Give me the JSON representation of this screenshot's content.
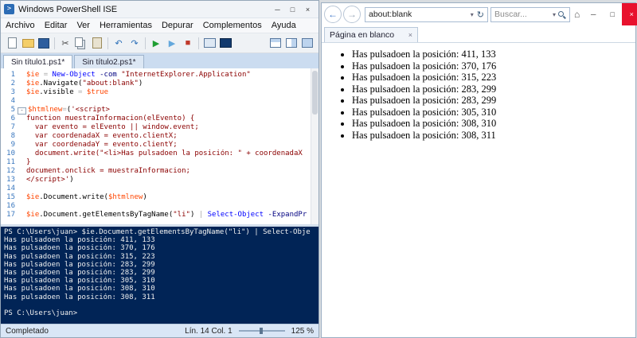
{
  "icons": {
    "app_glyph": ">",
    "ise_minimize": "─",
    "ise_maximize": "□",
    "ise_close": "×",
    "ie_minimize": "─",
    "ie_maximize": "□",
    "ie_close": "×",
    "ie_back": "←",
    "ie_forward": "→",
    "ie_refresh": "↻",
    "ie_dropdown": "▾",
    "ie_home": "⌂",
    "ie_tab_close": "×"
  },
  "ise": {
    "title": "Windows PowerShell ISE",
    "menu": [
      "Archivo",
      "Editar",
      "Ver",
      "Herramientas",
      "Depurar",
      "Complementos",
      "Ayuda"
    ],
    "toolbar": [
      {
        "name": "new-script",
        "kind": "shape"
      },
      {
        "name": "open-script",
        "kind": "shape"
      },
      {
        "name": "save-script",
        "kind": "shape"
      },
      {
        "name": "sep"
      },
      {
        "name": "cut",
        "kind": "glyph",
        "glyph": "✂",
        "color": "#444444"
      },
      {
        "name": "copy",
        "kind": "shape"
      },
      {
        "name": "paste",
        "kind": "shape"
      },
      {
        "name": "sep"
      },
      {
        "name": "undo",
        "kind": "glyph",
        "glyph": "↶",
        "color": "#2b6fb8"
      },
      {
        "name": "redo",
        "kind": "glyph",
        "glyph": "↷",
        "color": "#2b6fb8"
      },
      {
        "name": "sep"
      },
      {
        "name": "run-script",
        "kind": "glyph",
        "glyph": "▶",
        "color": "#1e9e32"
      },
      {
        "name": "run-selection",
        "kind": "glyph",
        "glyph": "▶",
        "color": "#64a8dc"
      },
      {
        "name": "stop-operation",
        "kind": "glyph",
        "glyph": "■",
        "color": "#c0392b"
      },
      {
        "name": "sep"
      },
      {
        "name": "new-remote-powershell-tab",
        "kind": "shape"
      },
      {
        "name": "start-powershell",
        "kind": "shape"
      }
    ],
    "toolbar_right": [
      {
        "name": "show-script-pane-top",
        "kind": "shape"
      },
      {
        "name": "show-script-pane-right",
        "kind": "shape"
      },
      {
        "name": "show-script-pane-maximized",
        "kind": "shape"
      }
    ],
    "tabs": [
      {
        "label": "Sin título1.ps1*",
        "active": true
      },
      {
        "label": "Sin título2.ps1*",
        "active": false
      }
    ],
    "editor_lines": [
      {
        "n": 1,
        "segs": [
          [
            "variable",
            "$ie"
          ],
          [
            "plain",
            " "
          ],
          [
            "operator",
            "="
          ],
          [
            "plain",
            " "
          ],
          [
            "cmdlet",
            "New-Object"
          ],
          [
            "plain",
            " "
          ],
          [
            "parameter",
            "-com"
          ],
          [
            "plain",
            " "
          ],
          [
            "string",
            "\"InternetExplorer.Application\""
          ]
        ]
      },
      {
        "n": 2,
        "segs": [
          [
            "variable",
            "$ie"
          ],
          [
            "plain",
            ".Navigate("
          ],
          [
            "string",
            "\"about:blank\""
          ],
          [
            "plain",
            ")"
          ]
        ]
      },
      {
        "n": 3,
        "segs": [
          [
            "variable",
            "$ie"
          ],
          [
            "plain",
            ".visible "
          ],
          [
            "operator",
            "="
          ],
          [
            "plain",
            " "
          ],
          [
            "variable",
            "$true"
          ]
        ]
      },
      {
        "n": 4,
        "segs": []
      },
      {
        "n": 5,
        "fold": true,
        "segs": [
          [
            "variable",
            "$htmlnew"
          ],
          [
            "operator",
            "="
          ],
          [
            "plain",
            "("
          ],
          [
            "string",
            "'<script>"
          ]
        ]
      },
      {
        "n": 6,
        "segs": [
          [
            "string",
            "function muestraInformacion(elEvento) {"
          ]
        ]
      },
      {
        "n": 7,
        "segs": [
          [
            "string",
            "  var evento = elEvento || window.event;"
          ]
        ]
      },
      {
        "n": 8,
        "segs": [
          [
            "string",
            "  var coordenadaX = evento.clientX;"
          ]
        ]
      },
      {
        "n": 9,
        "segs": [
          [
            "string",
            "  var coordenadaY = evento.clientY;"
          ]
        ]
      },
      {
        "n": 10,
        "segs": [
          [
            "string",
            "  document.write(\"<li>Has pulsadoen la posición: \" + coordenadaX"
          ]
        ]
      },
      {
        "n": 11,
        "segs": [
          [
            "string",
            "}"
          ]
        ]
      },
      {
        "n": 12,
        "segs": [
          [
            "string",
            "document.onclick = muestraInformacion;"
          ]
        ]
      },
      {
        "n": 13,
        "segs": [
          [
            "string",
            "</script>'"
          ],
          [
            "plain",
            ")"
          ]
        ]
      },
      {
        "n": 14,
        "segs": []
      },
      {
        "n": 15,
        "segs": [
          [
            "variable",
            "$ie"
          ],
          [
            "plain",
            ".Document.write("
          ],
          [
            "variable",
            "$htmlnew"
          ],
          [
            "plain",
            ")"
          ]
        ]
      },
      {
        "n": 16,
        "segs": []
      },
      {
        "n": 17,
        "segs": [
          [
            "variable",
            "$ie"
          ],
          [
            "plain",
            ".Document.getElementsByTagName("
          ],
          [
            "string",
            "\"li\""
          ],
          [
            "plain",
            ") "
          ],
          [
            "operator",
            "|"
          ],
          [
            "plain",
            " "
          ],
          [
            "cmdlet",
            "Select-Object"
          ],
          [
            "plain",
            " "
          ],
          [
            "parameter",
            "-ExpandPr"
          ]
        ]
      }
    ],
    "console_lines": [
      "PS C:\\Users\\juan> $ie.Document.getElementsByTagName(\"li\") | Select-Obje",
      "Has pulsadoen la posición: 411, 133",
      "Has pulsadoen la posición: 370, 176",
      "Has pulsadoen la posición: 315, 223",
      "Has pulsadoen la posición: 283, 299",
      "Has pulsadoen la posición: 283, 299",
      "Has pulsadoen la posición: 305, 310",
      "Has pulsadoen la posición: 308, 310",
      "Has pulsadoen la posición: 308, 311",
      "",
      "PS C:\\Users\\juan>"
    ],
    "status": {
      "state": "Completado",
      "line_col": "Lín. 14 Col. 1",
      "zoom": "125 %"
    }
  },
  "ie": {
    "address": "about:blank",
    "search_placeholder": "Buscar...",
    "tab_title": "Página en blanco",
    "list_items": [
      "Has pulsadoen la posición: 411, 133",
      "Has pulsadoen la posición: 370, 176",
      "Has pulsadoen la posición: 315, 223",
      "Has pulsadoen la posición: 283, 299",
      "Has pulsadoen la posición: 283, 299",
      "Has pulsadoen la posición: 305, 310",
      "Has pulsadoen la posición: 308, 310",
      "Has pulsadoen la posición: 308, 311"
    ]
  }
}
